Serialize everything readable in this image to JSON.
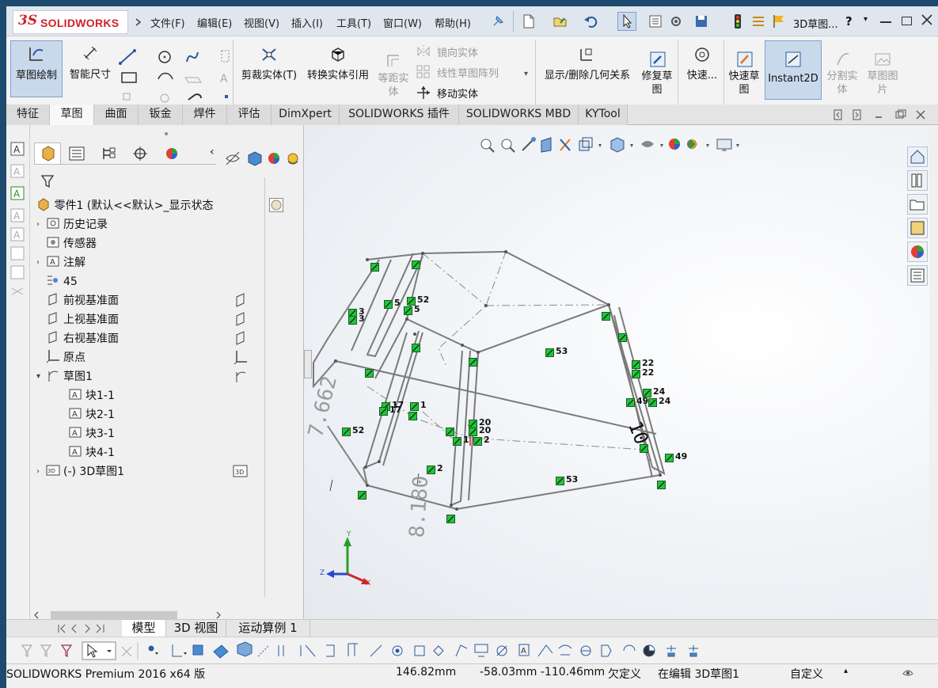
{
  "app": {
    "title": "3D草图...",
    "menus": [
      "文件(F)",
      "编辑(E)",
      "视图(V)",
      "插入(I)",
      "工具(T)",
      "窗口(W)",
      "帮助(H)"
    ]
  },
  "colors": {
    "brand": "#d2212c",
    "sketch_line": "#7a7a7a",
    "relation_badge": "#22c43a",
    "active_tool": "#bcd0e4"
  },
  "commands": {
    "sketch": "草图绘制",
    "smart_dim": "智能尺寸",
    "trim": "剪裁实体(T)",
    "convert": "转换实体引用",
    "offset": "等距实体",
    "mirror": "镜向实体",
    "linear_pattern": "线性草图阵列",
    "move": "移动实体",
    "display_relations": "显示/删除几何关系",
    "repair": "修复草图",
    "quick_snap": "快速...",
    "rapid_sketch": "快速草图",
    "instant2d": "Instant2D",
    "split": "分割实体",
    "sketch_picture": "草图图片"
  },
  "tabs": [
    "特征",
    "草图",
    "曲面",
    "钣金",
    "焊件",
    "评估",
    "DimXpert",
    "SOLIDWORKS 插件",
    "SOLIDWORKS MBD",
    "KYTool"
  ],
  "active_tab": "草图",
  "tree": {
    "root": "零件1 (默认<<默认>_显示状态",
    "items": [
      {
        "label": "历史记录",
        "icon": "history-icon",
        "expander": true
      },
      {
        "label": "传感器",
        "icon": "sensor-icon",
        "expander": false
      },
      {
        "label": "注解",
        "icon": "annotation-icon",
        "expander": true
      },
      {
        "label": "45",
        "icon": "material-icon",
        "expander": false
      },
      {
        "label": "前视基准面",
        "icon": "plane-icon",
        "expander": false
      },
      {
        "label": "上视基准面",
        "icon": "plane-icon",
        "expander": false
      },
      {
        "label": "右视基准面",
        "icon": "plane-icon",
        "expander": false
      },
      {
        "label": "原点",
        "icon": "origin-icon",
        "expander": false
      },
      {
        "label": "草图1",
        "icon": "sketch-icon",
        "expander": true
      },
      {
        "label": "块1-1",
        "icon": "block-icon",
        "expander": false
      },
      {
        "label": "块2-1",
        "icon": "block-icon",
        "expander": false
      },
      {
        "label": "块3-1",
        "icon": "block-icon",
        "expander": false
      },
      {
        "label": "块4-1",
        "icon": "block-icon",
        "expander": false
      },
      {
        "label": "(-) 3D草图1",
        "icon": "3d-sketch-icon",
        "expander": true
      }
    ]
  },
  "bottom_tabs": [
    "模型",
    "3D 视图",
    "运动算例 1"
  ],
  "status": {
    "product": "SOLIDWORKS Premium 2016 x64 版",
    "length": "146.82mm",
    "coords": "-58.03mm -110.46mm",
    "defined": "欠定义",
    "editing": "在编辑 3D草图1",
    "units": "自定义"
  },
  "viewport": {
    "relation_labels": [
      "52",
      "5",
      "5",
      "3",
      "3",
      "17",
      "17",
      "1",
      "52",
      "2",
      "20",
      "20",
      "1",
      "2",
      "53",
      "22",
      "22",
      "24",
      "24",
      "49",
      "49",
      "53"
    ],
    "dims": [
      "7.662",
      "8.180",
      "10"
    ],
    "triad": {
      "x": "X",
      "y": "Y",
      "z": "Z"
    }
  }
}
